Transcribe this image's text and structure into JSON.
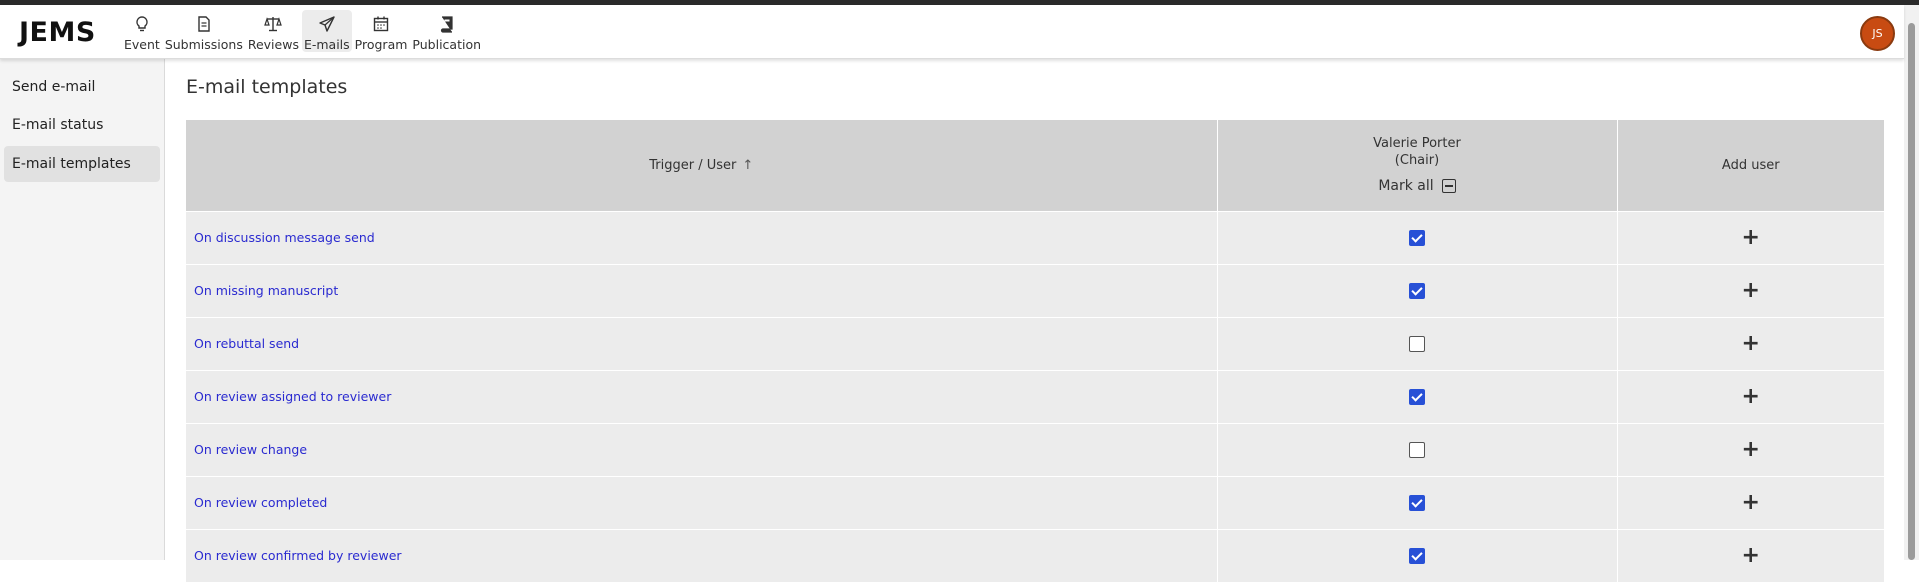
{
  "app": {
    "logo": "JEMS",
    "avatar_initials": "JS"
  },
  "nav": [
    {
      "label": "Event",
      "icon": "lightbulb-icon",
      "active": false
    },
    {
      "label": "Submissions",
      "icon": "document-icon",
      "active": false
    },
    {
      "label": "Reviews",
      "icon": "scale-icon",
      "active": false
    },
    {
      "label": "E-mails",
      "icon": "paper-plane-icon",
      "active": true
    },
    {
      "label": "Program",
      "icon": "calendar-icon",
      "active": false
    },
    {
      "label": "Publication",
      "icon": "book-icon",
      "active": false
    }
  ],
  "sidebar": {
    "items": [
      {
        "label": "Send e-mail",
        "active": false
      },
      {
        "label": "E-mail status",
        "active": false
      },
      {
        "label": "E-mail templates",
        "active": true
      }
    ]
  },
  "main": {
    "title": "E-mail templates",
    "table": {
      "col_trigger": "Trigger / User",
      "col_user_name": "Valerie Porter",
      "col_user_role": "(Chair)",
      "mark_all": "Mark all",
      "col_add": "Add user",
      "rows": [
        {
          "trigger": "On discussion message send",
          "checked": true
        },
        {
          "trigger": "On missing manuscript",
          "checked": true
        },
        {
          "trigger": "On rebuttal send",
          "checked": false
        },
        {
          "trigger": "On review assigned to reviewer",
          "checked": true
        },
        {
          "trigger": "On review change",
          "checked": false
        },
        {
          "trigger": "On review completed",
          "checked": true
        },
        {
          "trigger": "On review confirmed by reviewer",
          "checked": true
        }
      ]
    }
  },
  "colors": {
    "link": "#2a2ad0",
    "checkbox": "#2750d6",
    "avatar": "#c84b12",
    "header_bg": "#d2d2d2",
    "row_bg": "#ececec"
  }
}
